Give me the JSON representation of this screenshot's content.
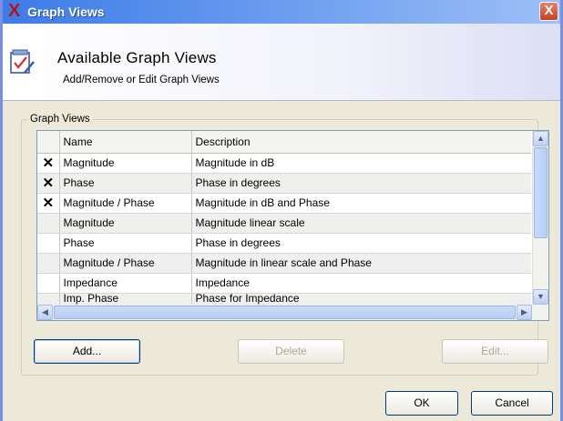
{
  "window": {
    "title": "Graph Views",
    "close_label": "X",
    "app_icon": "X"
  },
  "header": {
    "title": "Available Graph Views",
    "subtitle": "Add/Remove or Edit Graph Views"
  },
  "group": {
    "label": "Graph Views"
  },
  "table": {
    "columns": [
      "Name",
      "Description"
    ],
    "rows": [
      {
        "checked": "✕",
        "name": "Magnitude",
        "description": "Magnitude in dB"
      },
      {
        "checked": "✕",
        "name": "Phase",
        "description": "Phase in degrees"
      },
      {
        "checked": "✕",
        "name": "Magnitude / Phase",
        "description": "Magnitude in dB and Phase"
      },
      {
        "checked": "",
        "name": "Magnitude",
        "description": "Magnitude linear scale"
      },
      {
        "checked": "",
        "name": "Phase",
        "description": "Phase in degrees"
      },
      {
        "checked": "",
        "name": "Magnitude / Phase",
        "description": "Magnitude in linear scale and Phase"
      },
      {
        "checked": "",
        "name": "Impedance",
        "description": "Impedance"
      },
      {
        "checked": "",
        "name": "Imp. Phase",
        "description": "Phase for Impedance"
      }
    ]
  },
  "buttons": {
    "add": "Add...",
    "delete": "Delete",
    "edit": "Edit...",
    "ok": "OK",
    "cancel": "Cancel"
  },
  "icons": {
    "scroll_up": "▲",
    "scroll_down": "▼",
    "scroll_left": "◀",
    "scroll_right": "▶"
  }
}
